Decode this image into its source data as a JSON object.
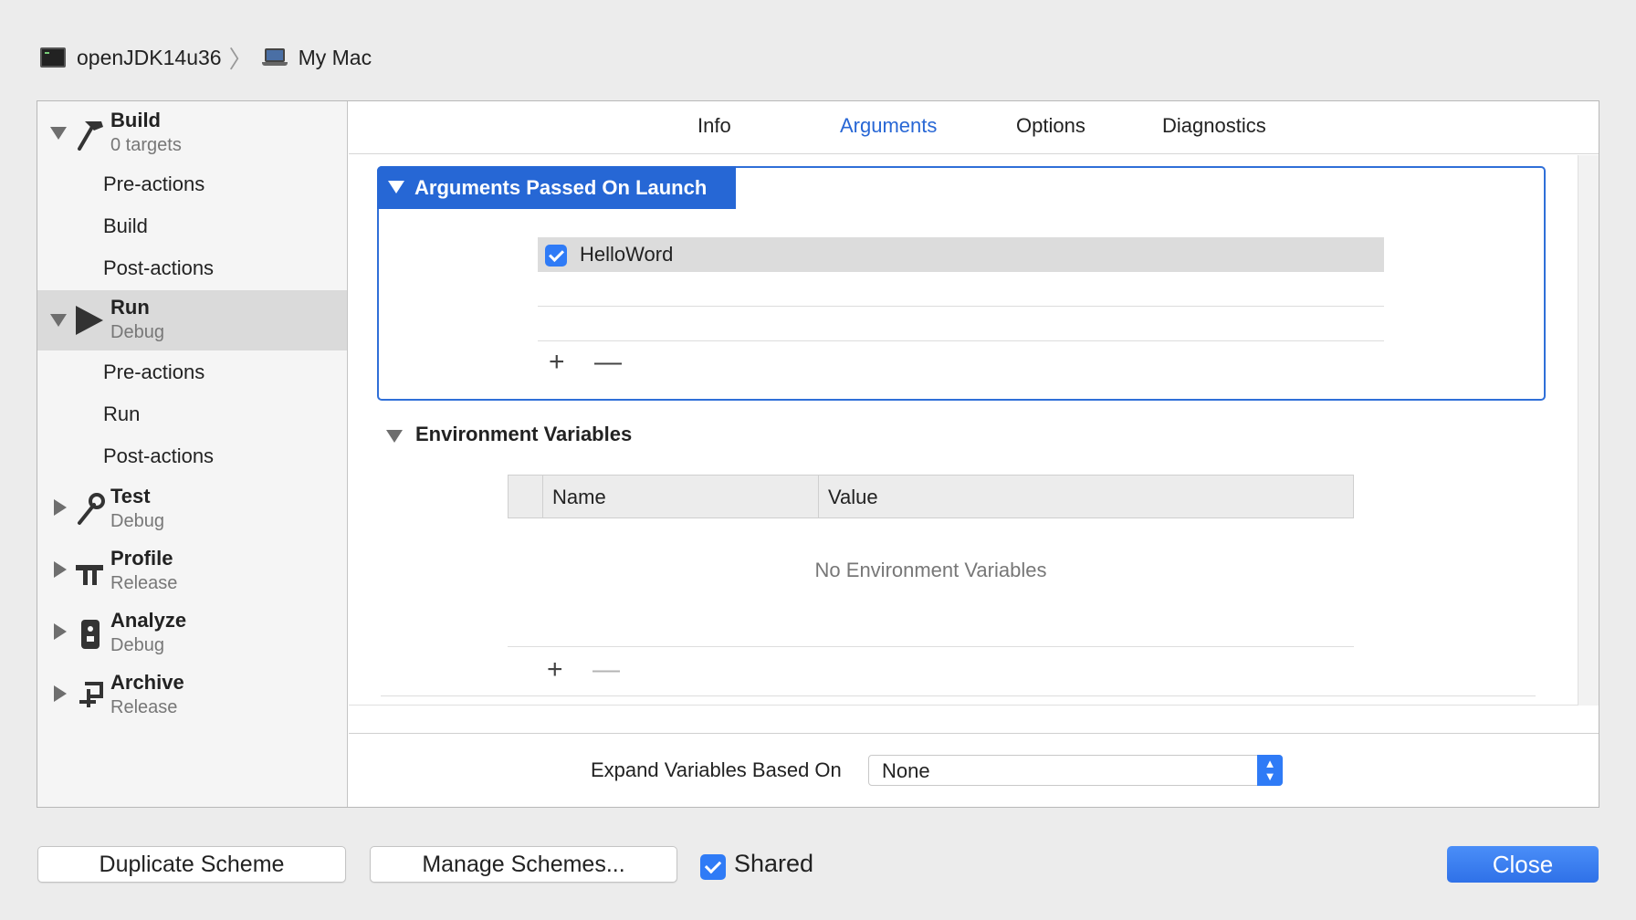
{
  "breadcrumb": {
    "scheme": "openJDK14u36",
    "destination": "My Mac"
  },
  "sidebar": {
    "sections": [
      {
        "title": "Build",
        "subtitle": "0 targets",
        "expanded": true,
        "items": [
          "Pre-actions",
          "Build",
          "Post-actions"
        ]
      },
      {
        "title": "Run",
        "subtitle": "Debug",
        "expanded": true,
        "selected": true,
        "items": [
          "Pre-actions",
          "Run",
          "Post-actions"
        ]
      },
      {
        "title": "Test",
        "subtitle": "Debug",
        "expanded": false
      },
      {
        "title": "Profile",
        "subtitle": "Release",
        "expanded": false
      },
      {
        "title": "Analyze",
        "subtitle": "Debug",
        "expanded": false
      },
      {
        "title": "Archive",
        "subtitle": "Release",
        "expanded": false
      }
    ]
  },
  "tabs": [
    {
      "label": "Info",
      "active": false
    },
    {
      "label": "Arguments",
      "active": true
    },
    {
      "label": "Options",
      "active": false
    },
    {
      "label": "Diagnostics",
      "active": false
    }
  ],
  "arguments": {
    "title": "Arguments Passed On Launch",
    "items": [
      {
        "value": "HelloWord",
        "enabled": true
      }
    ],
    "add": "+",
    "remove": "—"
  },
  "environment": {
    "title": "Environment Variables",
    "columns": [
      "Name",
      "Value"
    ],
    "empty_text": "No Environment Variables",
    "add": "+",
    "remove": "—"
  },
  "expand": {
    "label": "Expand Variables Based On",
    "value": "None"
  },
  "footer": {
    "duplicate": "Duplicate Scheme",
    "manage": "Manage Schemes...",
    "shared_label": "Shared",
    "shared_checked": true,
    "close": "Close"
  },
  "colors": {
    "accent": "#2667d5",
    "selected_row": "#dadada",
    "checkbox": "#2f7bf6"
  }
}
